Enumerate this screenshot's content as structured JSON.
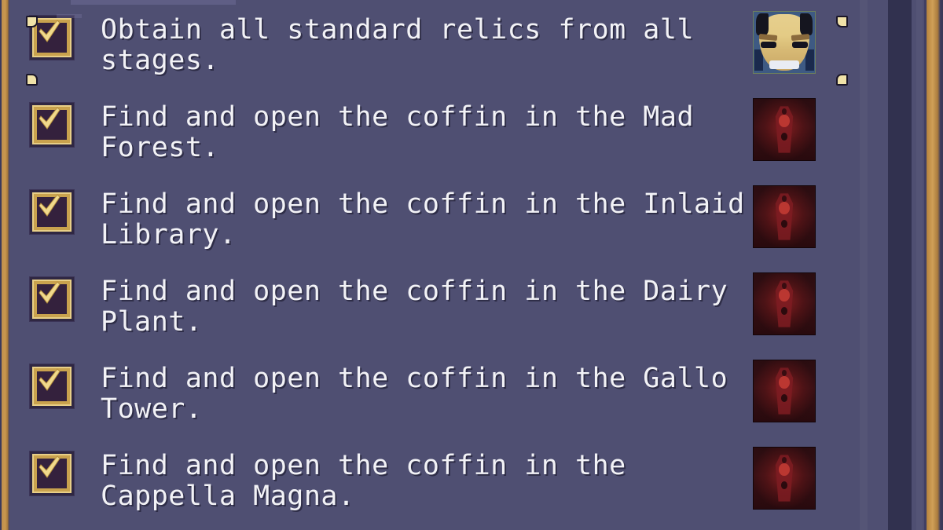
{
  "window": {
    "background_color": "#4f4f72",
    "border_color": "#c8984f",
    "text_color": "#f2f2f6"
  },
  "scrollbar": {
    "name": "vertical-scrollbar",
    "track_color": "#31314f",
    "thumb_color": "#c08d44",
    "position_percent": 15
  },
  "objectives": [
    {
      "checked": true,
      "checkbox_state": "checked",
      "text": "Obtain all standard relics from all\nstages.",
      "reward_icon": "mask-icon",
      "selected": true
    },
    {
      "checked": true,
      "checkbox_state": "checked",
      "text": "Find and open the coffin in the Mad\nForest.",
      "reward_icon": "coffin-icon",
      "selected": false
    },
    {
      "checked": true,
      "checkbox_state": "checked",
      "text": "Find and open the coffin in the Inlaid\nLibrary.",
      "reward_icon": "coffin-icon",
      "selected": false
    },
    {
      "checked": true,
      "checkbox_state": "checked",
      "text": "Find and open the coffin in the Dairy\nPlant.",
      "reward_icon": "coffin-icon",
      "selected": false
    },
    {
      "checked": true,
      "checkbox_state": "checked",
      "text": "Find and open the coffin in the Gallo\nTower.",
      "reward_icon": "coffin-icon",
      "selected": false
    },
    {
      "checked": true,
      "checkbox_state": "checked",
      "text": "Find and open the coffin in the\nCappella Magna.",
      "reward_icon": "coffin-icon",
      "selected": false
    }
  ]
}
